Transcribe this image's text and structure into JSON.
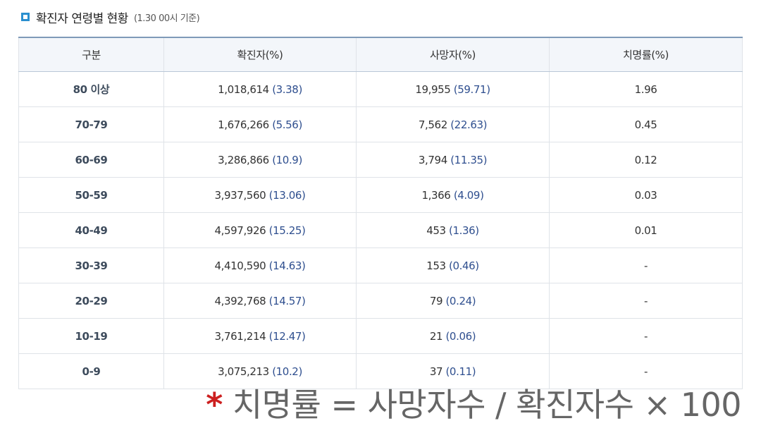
{
  "header": {
    "title": "확진자 연령별 현황",
    "note": "(1.30 00시 기준)"
  },
  "table": {
    "columns": [
      "구분",
      "확진자(%)",
      "사망자(%)",
      "치명률(%)"
    ],
    "rows": [
      {
        "category": "80 이상",
        "confirmed": "1,018,614",
        "confirmed_pct": "(3.38)",
        "deaths": "19,955",
        "deaths_pct": "(59.71)",
        "fatality": "1.96"
      },
      {
        "category": "70-79",
        "confirmed": "1,676,266",
        "confirmed_pct": "(5.56)",
        "deaths": "7,562",
        "deaths_pct": "(22.63)",
        "fatality": "0.45"
      },
      {
        "category": "60-69",
        "confirmed": "3,286,866",
        "confirmed_pct": "(10.9)",
        "deaths": "3,794",
        "deaths_pct": "(11.35)",
        "fatality": "0.12"
      },
      {
        "category": "50-59",
        "confirmed": "3,937,560",
        "confirmed_pct": "(13.06)",
        "deaths": "1,366",
        "deaths_pct": "(4.09)",
        "fatality": "0.03"
      },
      {
        "category": "40-49",
        "confirmed": "4,597,926",
        "confirmed_pct": "(15.25)",
        "deaths": "453",
        "deaths_pct": "(1.36)",
        "fatality": "0.01"
      },
      {
        "category": "30-39",
        "confirmed": "4,410,590",
        "confirmed_pct": "(14.63)",
        "deaths": "153",
        "deaths_pct": "(0.46)",
        "fatality": "-"
      },
      {
        "category": "20-29",
        "confirmed": "4,392,768",
        "confirmed_pct": "(14.57)",
        "deaths": "79",
        "deaths_pct": "(0.24)",
        "fatality": "-"
      },
      {
        "category": "10-19",
        "confirmed": "3,761,214",
        "confirmed_pct": "(12.47)",
        "deaths": "21",
        "deaths_pct": "(0.06)",
        "fatality": "-"
      },
      {
        "category": "0-9",
        "confirmed": "3,075,213",
        "confirmed_pct": "(10.2)",
        "deaths": "37",
        "deaths_pct": "(0.11)",
        "fatality": "-"
      }
    ]
  },
  "footnote": {
    "marker": "*",
    "text": "치명률 = 사망자수 / 확진자수 × 100"
  },
  "colors": {
    "accent": "#2a8fcf",
    "percent_text": "#2f4f8f",
    "footnote_marker": "#cc1f1f"
  }
}
